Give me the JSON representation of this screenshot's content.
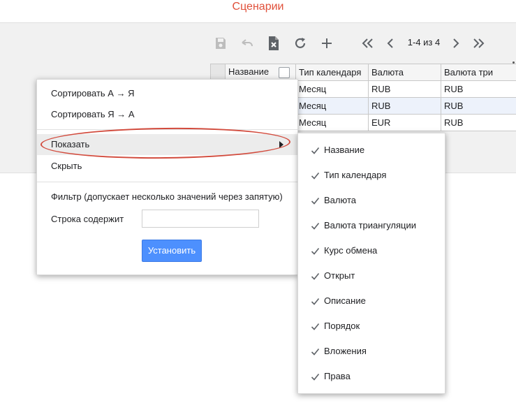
{
  "page": {
    "title": "Сценарии"
  },
  "toolbar": {
    "icons": [
      "save-icon",
      "undo-icon",
      "delete-file-icon",
      "refresh-icon",
      "add-icon",
      "first-page-icon",
      "prev-page-icon",
      "next-page-icon",
      "last-page-icon",
      "more-icon"
    ],
    "pager_text": "1-4 из 4"
  },
  "table": {
    "headers": [
      "Название",
      "Тип календаря",
      "Валюта",
      "Валюта три"
    ],
    "rows": [
      [
        "Месяц",
        "RUB",
        "RUB"
      ],
      [
        "Месяц",
        "RUB",
        "RUB"
      ],
      [
        "Месяц",
        "EUR",
        "RUB"
      ]
    ]
  },
  "menu": {
    "sort_asc": "Сортировать А → Я",
    "sort_desc": "Сортировать Я → А",
    "show": "Показать",
    "hide": "Скрыть",
    "filter_label": "Фильтр (допускает несколько значений через запятую)",
    "contains_label": "Строка содержит",
    "contains_value": "",
    "apply_button": "Установить"
  },
  "submenu": {
    "items": [
      {
        "label": "Название",
        "checked": true
      },
      {
        "label": "Тип календаря",
        "checked": true
      },
      {
        "label": "Валюта",
        "checked": true
      },
      {
        "label": "Валюта триангуляции",
        "checked": true
      },
      {
        "label": "Курс обмена",
        "checked": true
      },
      {
        "label": "Открыт",
        "checked": true
      },
      {
        "label": "Описание",
        "checked": true
      },
      {
        "label": "Порядок",
        "checked": true
      },
      {
        "label": "Вложения",
        "checked": true
      },
      {
        "label": "Права",
        "checked": true
      }
    ]
  },
  "colors": {
    "accent": "#4d90fe",
    "title": "#e0503a",
    "highlight_oval": "#d24a3c"
  }
}
